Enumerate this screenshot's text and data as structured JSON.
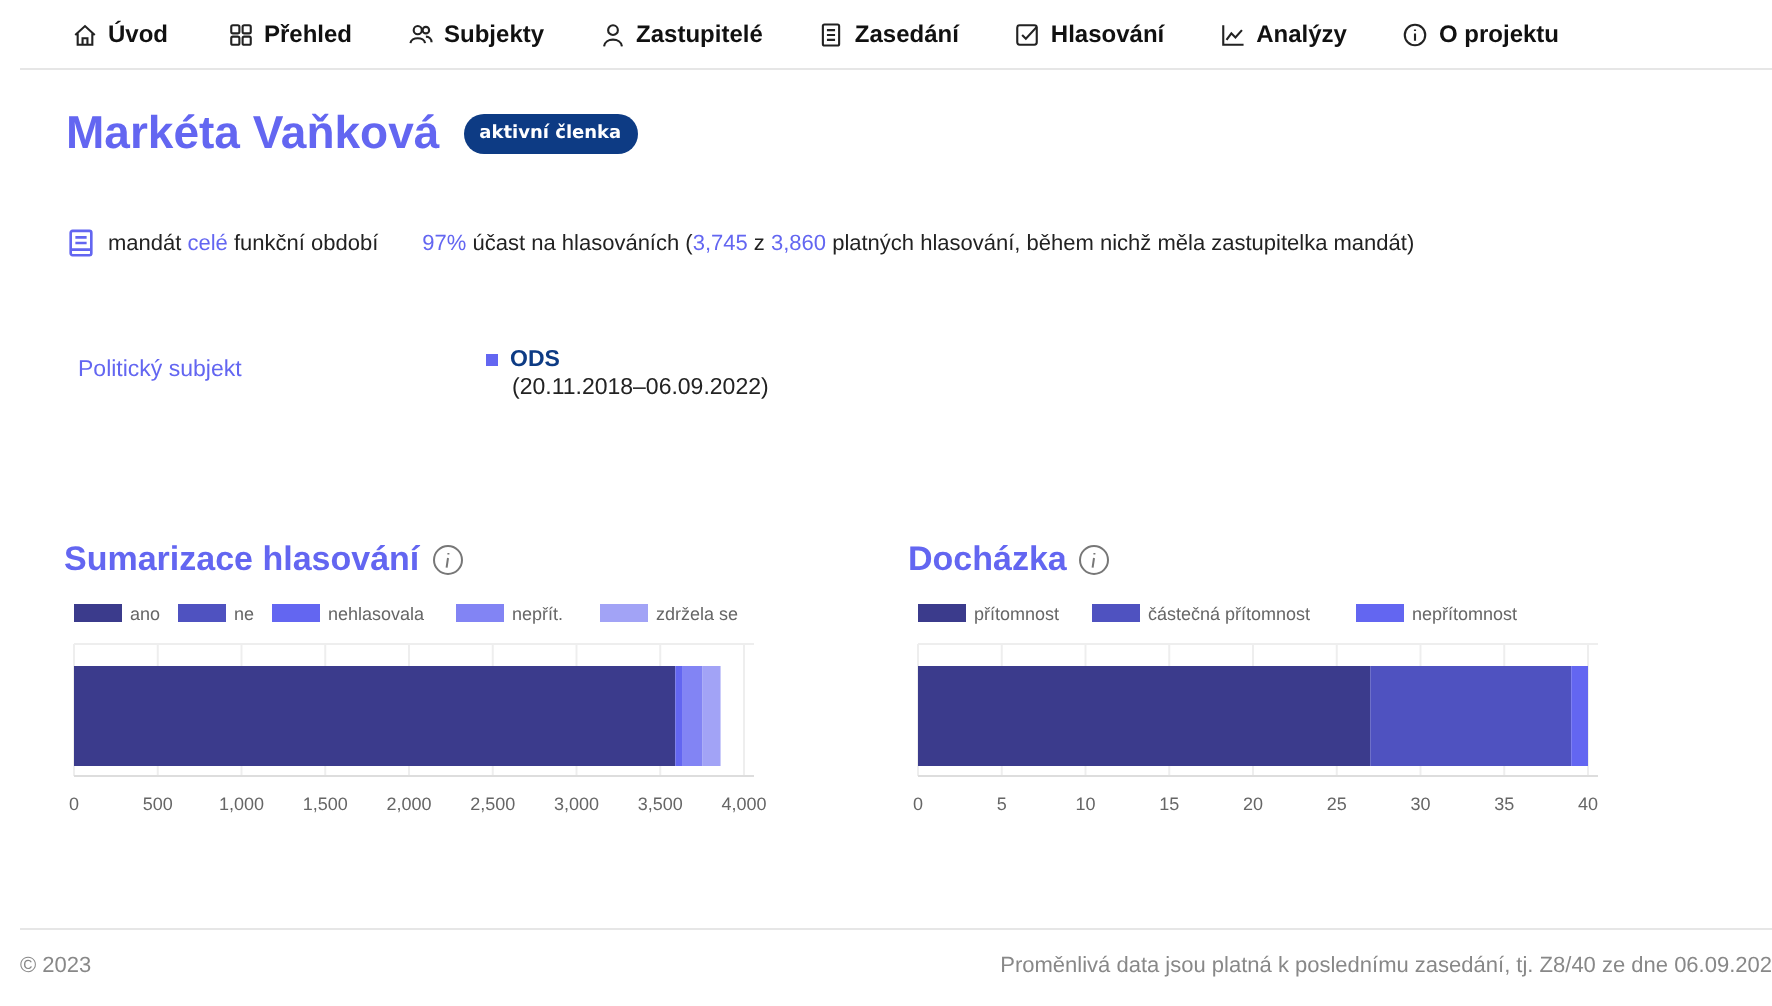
{
  "nav": [
    {
      "label": "Úvod"
    },
    {
      "label": "Přehled"
    },
    {
      "label": "Subjekty"
    },
    {
      "label": "Zastupitelé"
    },
    {
      "label": "Zasedání"
    },
    {
      "label": "Hlasování"
    },
    {
      "label": "Analýzy"
    },
    {
      "label": "O projektu"
    }
  ],
  "person": {
    "name": "Markéta Vaňková",
    "badge": "aktivní členka"
  },
  "mandate": [
    {
      "text": "mandát ",
      "highlight": false
    },
    {
      "text": "celé",
      "highlight": true
    },
    {
      "text": " funkční období",
      "highlight": false
    }
  ],
  "participation": [
    {
      "text": "97%",
      "highlight": true
    },
    {
      "text": " účast na hlasováních (",
      "highlight": false
    },
    {
      "text": "3,745",
      "highlight": true
    },
    {
      "text": " z ",
      "highlight": false
    },
    {
      "text": "3,860",
      "highlight": true
    },
    {
      "text": " platných hlasování, během nichž měla zastupitelka mandát)",
      "highlight": false
    }
  ],
  "political_subject": {
    "label": "Politický subjekt",
    "party": "ODS",
    "color": "#6366f1",
    "period": "(20.11.2018–06.09.2022)"
  },
  "charts": [
    {
      "title": "Sumarizace hlasování",
      "chart_data": {
        "type": "bar",
        "orientation": "horizontal",
        "stacked": true,
        "grid": true,
        "legend": "top",
        "xlim": [
          0,
          4000
        ],
        "xticks": [
          {
            "value": 0,
            "label": "0"
          },
          {
            "value": 500,
            "label": "500"
          },
          {
            "value": 1000,
            "label": "1,000"
          },
          {
            "value": 1500,
            "label": "1,500"
          },
          {
            "value": 2000,
            "label": "2,000"
          },
          {
            "value": 2500,
            "label": "2,500"
          },
          {
            "value": 3000,
            "label": "3,000"
          },
          {
            "value": 3500,
            "label": "3,500"
          },
          {
            "value": 4000,
            "label": "4,000"
          }
        ],
        "series": [
          {
            "name": "ano",
            "color": "#3b3b8c",
            "values": [
              3590
            ]
          },
          {
            "name": "ne",
            "color": "#4f52c0",
            "values": [
              0
            ]
          },
          {
            "name": "nehlasovala",
            "color": "#6366f1",
            "values": [
              40
            ]
          },
          {
            "name": "nepřít.",
            "color": "#8284f4",
            "values": [
              120
            ]
          },
          {
            "name": "zdržela se",
            "color": "#a2a3f6",
            "values": [
              110
            ]
          }
        ]
      }
    },
    {
      "title": "Docházka",
      "chart_data": {
        "type": "bar",
        "orientation": "horizontal",
        "stacked": true,
        "grid": true,
        "legend": "top",
        "xlim": [
          0,
          40
        ],
        "xticks": [
          0,
          5,
          10,
          15,
          20,
          25,
          30,
          35,
          40
        ],
        "series": [
          {
            "name": "přítomnost",
            "color": "#3b3b8c",
            "values": [
              27
            ]
          },
          {
            "name": "částečná přítomnost",
            "color": "#4f52c0",
            "values": [
              12
            ]
          },
          {
            "name": "nepřítomnost",
            "color": "#6366f1",
            "values": [
              1
            ]
          }
        ]
      }
    }
  ],
  "footer": {
    "copyright": "© 2023",
    "note": "Proměnlivá data jsou platná k poslednímu zasedání, tj. Z8/40 ze dne 06.09.202"
  }
}
